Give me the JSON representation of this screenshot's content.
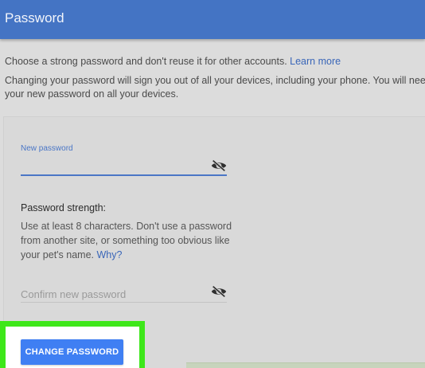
{
  "header": {
    "title": "Password"
  },
  "intro": {
    "line1_text": "Choose a strong password and don't reuse it for other accounts. ",
    "learn_more": "Learn more",
    "line2_text": "Changing your password will sign you out of all your devices, including your phone. You will need to",
    "line3_text": "your new password on all your devices."
  },
  "new_password": {
    "label": "New password",
    "value": ""
  },
  "strength": {
    "title": "Password strength:",
    "text": "Use at least 8 characters. Don't use a password from another site, or something too obvious like your pet's name. ",
    "why_link": "Why?"
  },
  "confirm": {
    "placeholder": "Confirm new password",
    "value": ""
  },
  "button": {
    "label": "CHANGE PASSWORD"
  },
  "colors": {
    "header_bg": "#4474c4",
    "accent": "#4a76c6",
    "button_bg": "#3f7ff3",
    "highlight": "#3ee71a"
  },
  "icons": [
    "visibility-off-icon",
    "visibility-off-icon"
  ]
}
